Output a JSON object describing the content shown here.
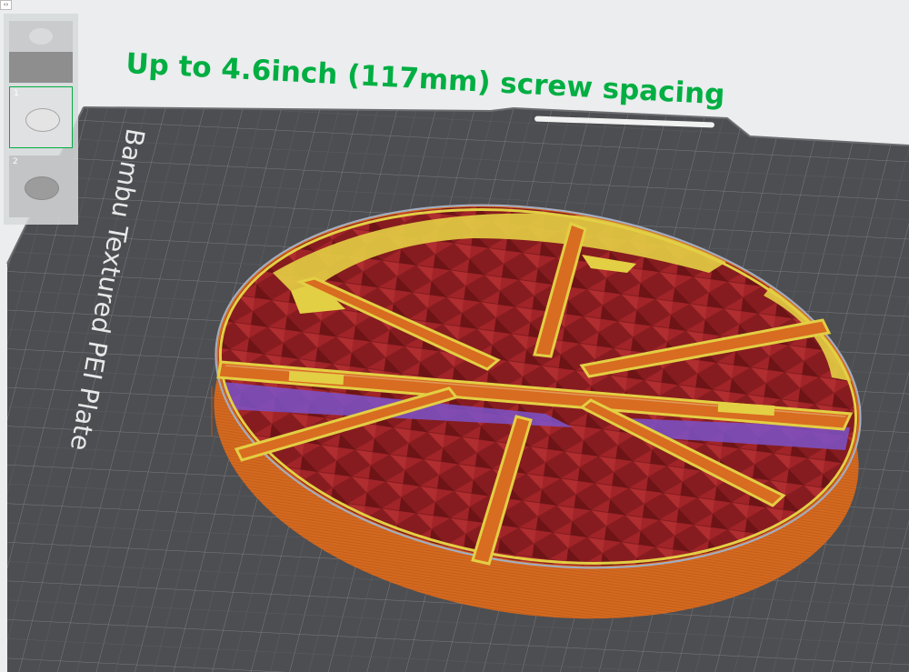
{
  "app": {
    "plate_panel": {
      "toggle_glyph": "‹›",
      "thumbnails": [
        {
          "number": "",
          "selected": false
        },
        {
          "number": "1",
          "selected": true
        },
        {
          "number": "2",
          "selected": false
        }
      ]
    }
  },
  "scene": {
    "plate_label": "Bambu Textured PEI Plate",
    "annotation": "Up to 4.6inch (117mm) screw spacing",
    "colors": {
      "annotation": "#00ae42",
      "bed": "#4d4e52",
      "grid": "#8a8b8e",
      "wall": "#d2661c",
      "infill": "#8b1d20",
      "ironing": "#e3cf44",
      "support": "#7b52c9",
      "selection": "#00ae42"
    }
  }
}
